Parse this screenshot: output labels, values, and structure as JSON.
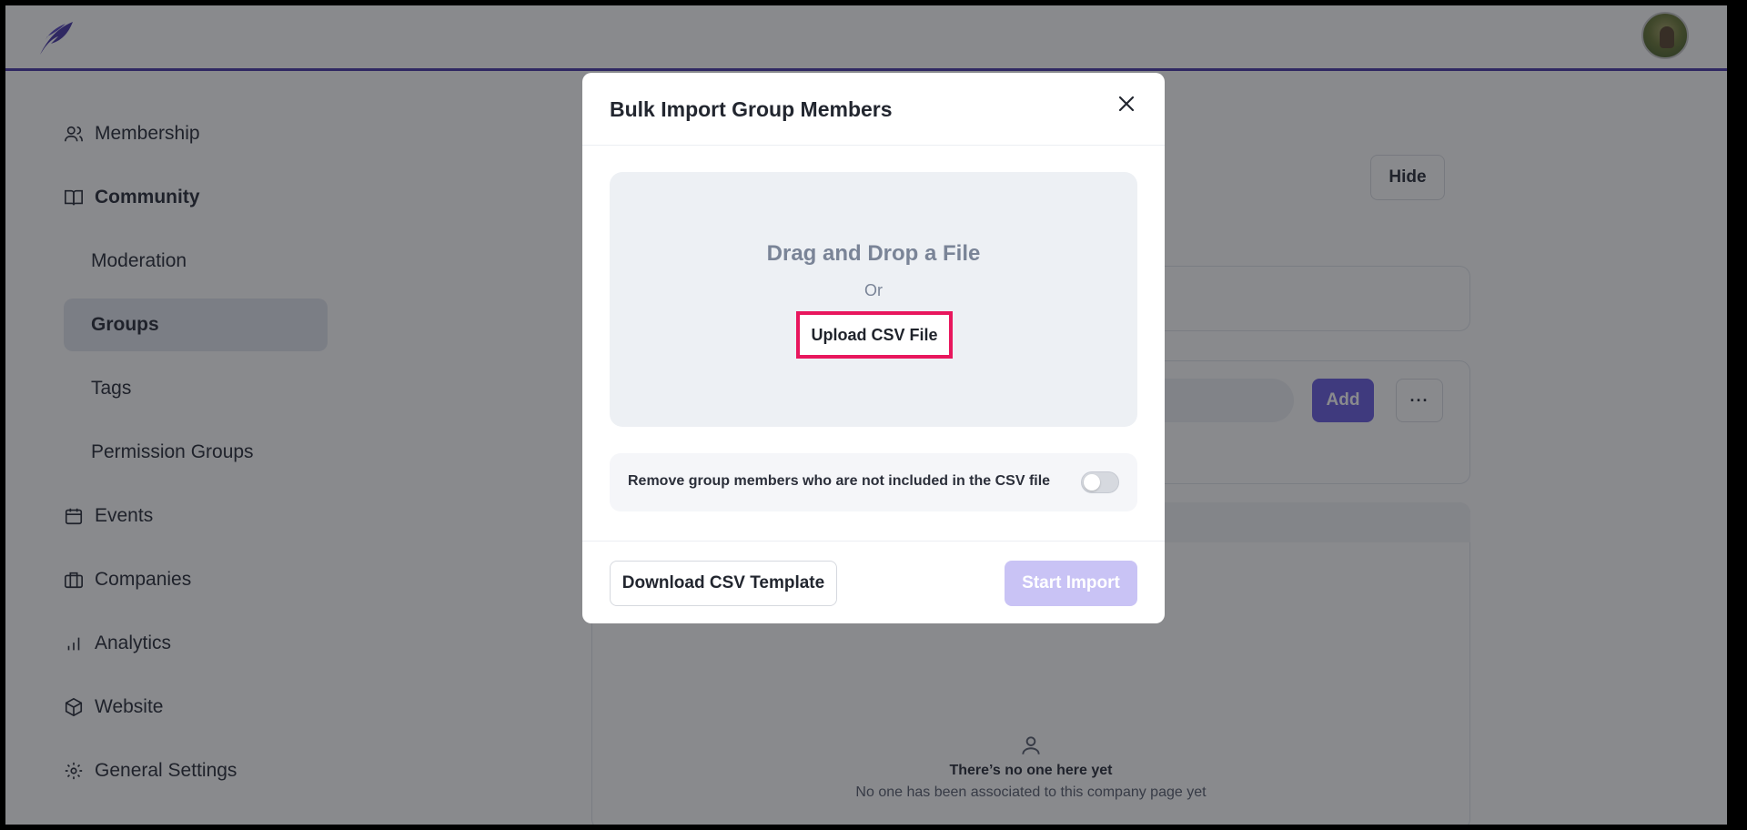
{
  "sidebar": {
    "items": [
      {
        "label": "Membership",
        "icon": "users-icon"
      },
      {
        "label": "Community",
        "icon": "book-open-icon"
      },
      {
        "label": "Moderation"
      },
      {
        "label": "Groups"
      },
      {
        "label": "Tags"
      },
      {
        "label": "Permission Groups"
      },
      {
        "label": "Events",
        "icon": "calendar-icon"
      },
      {
        "label": "Companies",
        "icon": "briefcase-icon"
      },
      {
        "label": "Analytics",
        "icon": "bar-chart-icon"
      },
      {
        "label": "Website",
        "icon": "cube-icon"
      },
      {
        "label": "General Settings",
        "icon": "gear-icon"
      }
    ]
  },
  "main": {
    "hide_label": "Hide",
    "add_label": "Add",
    "more_label": "···",
    "empty_title": "There’s no one here yet",
    "empty_subtitle": "No one has been associated to this company page yet"
  },
  "modal": {
    "title": "Bulk Import Group Members",
    "dropzone_title": "Drag and Drop a File",
    "dropzone_or": "Or",
    "upload_label": "Upload CSV File",
    "toggle_label": "Remove group members who are not included in the CSV file",
    "toggle_on": false,
    "download_label": "Download CSV Template",
    "start_label": "Start Import"
  },
  "colors": {
    "brand": "#4a3aa8",
    "accent": "#6b5fe0",
    "highlight": "#e8175d",
    "disabled_button": "#c9c3f5"
  }
}
